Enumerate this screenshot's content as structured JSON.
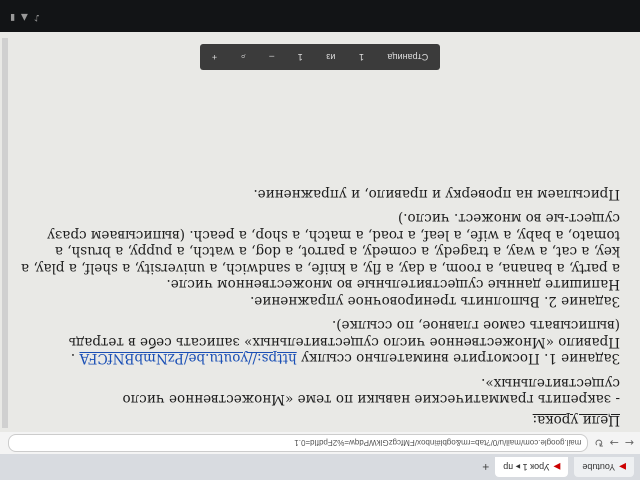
{
  "browser": {
    "tabs": [
      {
        "label": "Youtube"
      },
      {
        "label": "Урок 1 ▸ пр"
      }
    ],
    "url": "mail.google.com/mail/u/0/?tab=rm&ogbl#inbox/FMfcgzGlkWPdqw=%2FpdfId=0.1"
  },
  "document": {
    "heading": "Цели урока:",
    "goal": "- закрепить грамматические навыки по теме «Множественное число существительных».",
    "task1_prefix": "Задание 1. Посмотрите внимательно ссылку ",
    "task1_link": "https://youtu.be/PzNmbBNfCFA",
    "task1_suffix": " . Правило «Множественное число существительных» записать себе в тетрадь (выписывать самое главное, по ссылке).",
    "task2_title": "Задание 2. Выполнить тренировочное упражнение.",
    "task2_instruction": "Напишите данные существительные во множественном числе.",
    "task2_words": "a party, a banana, a room, a day, a fly, a knife, a sandwich, a university, a shelf, a play, a key, a cat, a way, a tragedy, a comedy, a parrot, a dog, a watch, a puppy, a brush, a tomato, a baby, a wife, a leaf, a road, a match, a shop, a peach. (выписываем сразу сущест-ые во множест. число.)",
    "footer": "Присылаем на проверку и правило, и упражнение."
  },
  "pdf_toolbar": {
    "page_label": "Страница",
    "page_current": "1",
    "page_sep": "из",
    "page_total": "1"
  }
}
